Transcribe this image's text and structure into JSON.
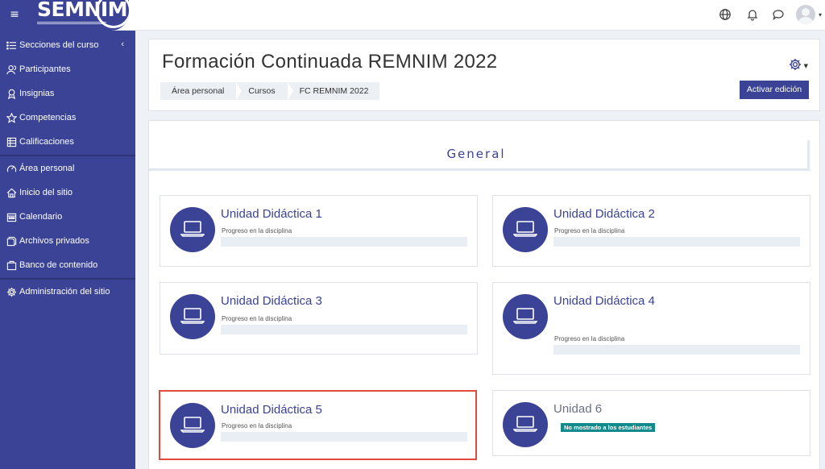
{
  "navbar": {
    "menu_icon": "hamburger-icon",
    "logo_text": "SEMNIM",
    "icons": [
      "globe-icon",
      "bell-icon",
      "chat-icon",
      "avatar"
    ]
  },
  "sidebar": {
    "items": [
      {
        "label": "Secciones del curso",
        "icon": "list-icon"
      },
      {
        "label": "Participantes",
        "icon": "users-icon"
      },
      {
        "label": "Insignias",
        "icon": "badge-icon"
      },
      {
        "label": "Competencias",
        "icon": "star-icon"
      },
      {
        "label": "Calificaciones",
        "icon": "grades-icon"
      },
      {
        "label": "Área personal",
        "icon": "dashboard-icon"
      },
      {
        "label": "Inicio del sitio",
        "icon": "home-icon"
      },
      {
        "label": "Calendario",
        "icon": "calendar-icon"
      },
      {
        "label": "Archivos privados",
        "icon": "files-icon"
      },
      {
        "label": "Banco de contenido",
        "icon": "content-bank-icon"
      },
      {
        "label": "Administración del sitio",
        "icon": "gear-icon"
      }
    ],
    "collapse_glyph": "‹"
  },
  "header": {
    "title": "Formación Continuada REMNIM 2022",
    "breadcrumb": [
      "Área personal",
      "Cursos",
      "FC REMNIM 2022"
    ],
    "edit_button": "Activar edición"
  },
  "section": {
    "title": "General"
  },
  "units": [
    {
      "title": "Unidad Didáctica 1",
      "progress_label": "Progreso en la disciplina",
      "progress": 0
    },
    {
      "title": "Unidad Didáctica 2",
      "progress_label": "Progreso en la disciplina",
      "progress": 0
    },
    {
      "title": "Unidad Didáctica 3",
      "progress_label": "Progreso en la disciplina",
      "progress": 0
    },
    {
      "title": "Unidad Didáctica 4",
      "progress_label": "Progreso en la disciplina",
      "progress": 0
    },
    {
      "title": "Unidad Didáctica 5",
      "progress_label": "Progreso en la disciplina",
      "progress": 0
    },
    {
      "title": "Unidad 6",
      "badge": "No mostrado a los estudiantes"
    }
  ],
  "colors": {
    "brand": "#3a4395",
    "highlight": "#e24b3b",
    "badge": "#138a8c"
  }
}
